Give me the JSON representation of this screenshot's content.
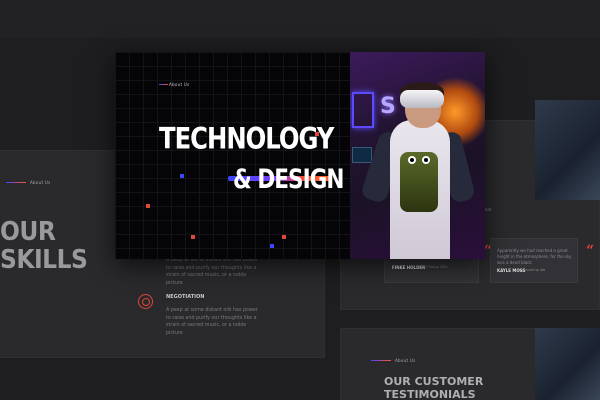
{
  "main_slide": {
    "label": "About Us",
    "title_line1": "TECHNOLOGY",
    "title_line2": "& DESIGN"
  },
  "skills_slide": {
    "label": "About Us",
    "heading_line1": "OUR",
    "heading_line2": "SKILLS",
    "paragraph_top": "A peep at some distant orb has power to raise and purify our thoughts like a strain of sacred music, or a noble picture",
    "skill_title": "NEGOTIATION",
    "paragraph_bottom": "A peep at some distant orb has power to raise and purify our thoughts like a strain of sacred music, or a noble picture"
  },
  "testimonial_slide": {
    "card1_name": "FINKE HOLDER",
    "card1_sub": "- NFT Group CEO",
    "card2_text": "Apparently we had reached a great height in the atmosphere, for the sky was a dead black",
    "card2_name": "KAYLE MOSS",
    "card2_sub": "- Counseling lab",
    "heading_line1": "OUR CUSTOMER",
    "heading_line2": "TESTIMONIALS",
    "label": "About Us",
    "side_text": "hat"
  },
  "colors": {
    "accent_red": "#e0463a",
    "accent_blue": "#3b47ff",
    "background": "#1e1e20"
  }
}
